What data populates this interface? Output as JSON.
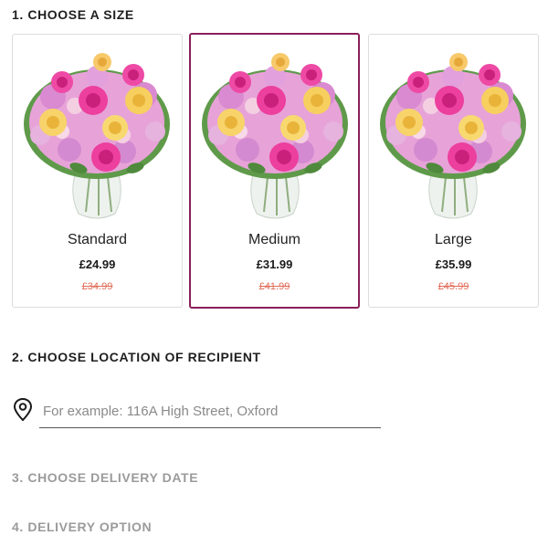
{
  "steps": {
    "size_title": "1. CHOOSE A SIZE",
    "location_title": "2. CHOOSE LOCATION OF RECIPIENT",
    "date_title": "3. CHOOSE DELIVERY DATE",
    "option_title": "4. DELIVERY OPTION"
  },
  "sizes": [
    {
      "name": "Standard",
      "price": "£24.99",
      "was": "£34.99",
      "selected": false
    },
    {
      "name": "Medium",
      "price": "£31.99",
      "was": "£41.99",
      "selected": true
    },
    {
      "name": "Large",
      "price": "£35.99",
      "was": "£45.99",
      "selected": false
    }
  ],
  "location": {
    "placeholder": "For example: 116A High Street, Oxford",
    "value": "",
    "icon": "location-pin-icon"
  },
  "colors": {
    "selected_border": "#8a1f5a",
    "strike_price": "#e06a55",
    "muted_heading": "#9b9b9b"
  }
}
